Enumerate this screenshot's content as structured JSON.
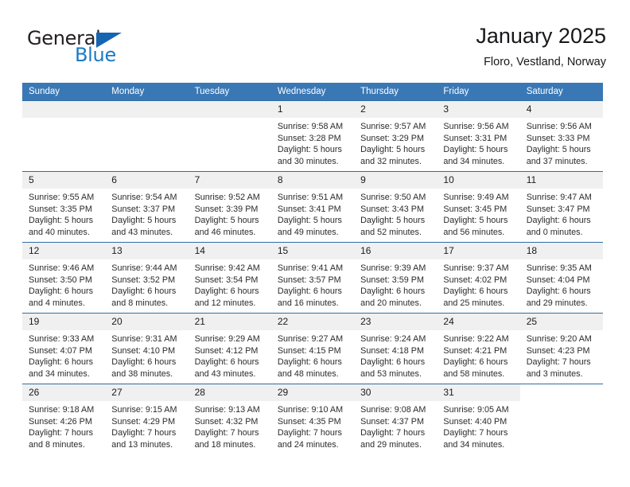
{
  "brand": {
    "name_part1": "General",
    "name_part2": "Blue",
    "triangle_color": "#1565b0",
    "blue_color": "#1a7ac4"
  },
  "header": {
    "title": "January 2025",
    "subtitle": "Floro, Vestland, Norway",
    "header_bg": "#3a78b5",
    "row_border": "#2e6da4",
    "daynum_bg": "#f0f0f0"
  },
  "weekday_headers": [
    "Sunday",
    "Monday",
    "Tuesday",
    "Wednesday",
    "Thursday",
    "Friday",
    "Saturday"
  ],
  "labels": {
    "sunrise": "Sunrise:",
    "sunset": "Sunset:",
    "daylight": "Daylight:"
  },
  "weeks": [
    [
      {
        "day": "",
        "empty": true
      },
      {
        "day": "",
        "empty": true
      },
      {
        "day": "",
        "empty": true
      },
      {
        "day": "1",
        "sunrise": "Sunrise: 9:58 AM",
        "sunset": "Sunset: 3:28 PM",
        "daylight_l1": "Daylight: 5 hours",
        "daylight_l2": "and 30 minutes."
      },
      {
        "day": "2",
        "sunrise": "Sunrise: 9:57 AM",
        "sunset": "Sunset: 3:29 PM",
        "daylight_l1": "Daylight: 5 hours",
        "daylight_l2": "and 32 minutes."
      },
      {
        "day": "3",
        "sunrise": "Sunrise: 9:56 AM",
        "sunset": "Sunset: 3:31 PM",
        "daylight_l1": "Daylight: 5 hours",
        "daylight_l2": "and 34 minutes."
      },
      {
        "day": "4",
        "sunrise": "Sunrise: 9:56 AM",
        "sunset": "Sunset: 3:33 PM",
        "daylight_l1": "Daylight: 5 hours",
        "daylight_l2": "and 37 minutes."
      }
    ],
    [
      {
        "day": "5",
        "sunrise": "Sunrise: 9:55 AM",
        "sunset": "Sunset: 3:35 PM",
        "daylight_l1": "Daylight: 5 hours",
        "daylight_l2": "and 40 minutes."
      },
      {
        "day": "6",
        "sunrise": "Sunrise: 9:54 AM",
        "sunset": "Sunset: 3:37 PM",
        "daylight_l1": "Daylight: 5 hours",
        "daylight_l2": "and 43 minutes."
      },
      {
        "day": "7",
        "sunrise": "Sunrise: 9:52 AM",
        "sunset": "Sunset: 3:39 PM",
        "daylight_l1": "Daylight: 5 hours",
        "daylight_l2": "and 46 minutes."
      },
      {
        "day": "8",
        "sunrise": "Sunrise: 9:51 AM",
        "sunset": "Sunset: 3:41 PM",
        "daylight_l1": "Daylight: 5 hours",
        "daylight_l2": "and 49 minutes."
      },
      {
        "day": "9",
        "sunrise": "Sunrise: 9:50 AM",
        "sunset": "Sunset: 3:43 PM",
        "daylight_l1": "Daylight: 5 hours",
        "daylight_l2": "and 52 minutes."
      },
      {
        "day": "10",
        "sunrise": "Sunrise: 9:49 AM",
        "sunset": "Sunset: 3:45 PM",
        "daylight_l1": "Daylight: 5 hours",
        "daylight_l2": "and 56 minutes."
      },
      {
        "day": "11",
        "sunrise": "Sunrise: 9:47 AM",
        "sunset": "Sunset: 3:47 PM",
        "daylight_l1": "Daylight: 6 hours",
        "daylight_l2": "and 0 minutes."
      }
    ],
    [
      {
        "day": "12",
        "sunrise": "Sunrise: 9:46 AM",
        "sunset": "Sunset: 3:50 PM",
        "daylight_l1": "Daylight: 6 hours",
        "daylight_l2": "and 4 minutes."
      },
      {
        "day": "13",
        "sunrise": "Sunrise: 9:44 AM",
        "sunset": "Sunset: 3:52 PM",
        "daylight_l1": "Daylight: 6 hours",
        "daylight_l2": "and 8 minutes."
      },
      {
        "day": "14",
        "sunrise": "Sunrise: 9:42 AM",
        "sunset": "Sunset: 3:54 PM",
        "daylight_l1": "Daylight: 6 hours",
        "daylight_l2": "and 12 minutes."
      },
      {
        "day": "15",
        "sunrise": "Sunrise: 9:41 AM",
        "sunset": "Sunset: 3:57 PM",
        "daylight_l1": "Daylight: 6 hours",
        "daylight_l2": "and 16 minutes."
      },
      {
        "day": "16",
        "sunrise": "Sunrise: 9:39 AM",
        "sunset": "Sunset: 3:59 PM",
        "daylight_l1": "Daylight: 6 hours",
        "daylight_l2": "and 20 minutes."
      },
      {
        "day": "17",
        "sunrise": "Sunrise: 9:37 AM",
        "sunset": "Sunset: 4:02 PM",
        "daylight_l1": "Daylight: 6 hours",
        "daylight_l2": "and 25 minutes."
      },
      {
        "day": "18",
        "sunrise": "Sunrise: 9:35 AM",
        "sunset": "Sunset: 4:04 PM",
        "daylight_l1": "Daylight: 6 hours",
        "daylight_l2": "and 29 minutes."
      }
    ],
    [
      {
        "day": "19",
        "sunrise": "Sunrise: 9:33 AM",
        "sunset": "Sunset: 4:07 PM",
        "daylight_l1": "Daylight: 6 hours",
        "daylight_l2": "and 34 minutes."
      },
      {
        "day": "20",
        "sunrise": "Sunrise: 9:31 AM",
        "sunset": "Sunset: 4:10 PM",
        "daylight_l1": "Daylight: 6 hours",
        "daylight_l2": "and 38 minutes."
      },
      {
        "day": "21",
        "sunrise": "Sunrise: 9:29 AM",
        "sunset": "Sunset: 4:12 PM",
        "daylight_l1": "Daylight: 6 hours",
        "daylight_l2": "and 43 minutes."
      },
      {
        "day": "22",
        "sunrise": "Sunrise: 9:27 AM",
        "sunset": "Sunset: 4:15 PM",
        "daylight_l1": "Daylight: 6 hours",
        "daylight_l2": "and 48 minutes."
      },
      {
        "day": "23",
        "sunrise": "Sunrise: 9:24 AM",
        "sunset": "Sunset: 4:18 PM",
        "daylight_l1": "Daylight: 6 hours",
        "daylight_l2": "and 53 minutes."
      },
      {
        "day": "24",
        "sunrise": "Sunrise: 9:22 AM",
        "sunset": "Sunset: 4:21 PM",
        "daylight_l1": "Daylight: 6 hours",
        "daylight_l2": "and 58 minutes."
      },
      {
        "day": "25",
        "sunrise": "Sunrise: 9:20 AM",
        "sunset": "Sunset: 4:23 PM",
        "daylight_l1": "Daylight: 7 hours",
        "daylight_l2": "and 3 minutes."
      }
    ],
    [
      {
        "day": "26",
        "sunrise": "Sunrise: 9:18 AM",
        "sunset": "Sunset: 4:26 PM",
        "daylight_l1": "Daylight: 7 hours",
        "daylight_l2": "and 8 minutes."
      },
      {
        "day": "27",
        "sunrise": "Sunrise: 9:15 AM",
        "sunset": "Sunset: 4:29 PM",
        "daylight_l1": "Daylight: 7 hours",
        "daylight_l2": "and 13 minutes."
      },
      {
        "day": "28",
        "sunrise": "Sunrise: 9:13 AM",
        "sunset": "Sunset: 4:32 PM",
        "daylight_l1": "Daylight: 7 hours",
        "daylight_l2": "and 18 minutes."
      },
      {
        "day": "29",
        "sunrise": "Sunrise: 9:10 AM",
        "sunset": "Sunset: 4:35 PM",
        "daylight_l1": "Daylight: 7 hours",
        "daylight_l2": "and 24 minutes."
      },
      {
        "day": "30",
        "sunrise": "Sunrise: 9:08 AM",
        "sunset": "Sunset: 4:37 PM",
        "daylight_l1": "Daylight: 7 hours",
        "daylight_l2": "and 29 minutes."
      },
      {
        "day": "31",
        "sunrise": "Sunrise: 9:05 AM",
        "sunset": "Sunset: 4:40 PM",
        "daylight_l1": "Daylight: 7 hours",
        "daylight_l2": "and 34 minutes."
      },
      {
        "day": "",
        "trailing": true
      }
    ]
  ]
}
